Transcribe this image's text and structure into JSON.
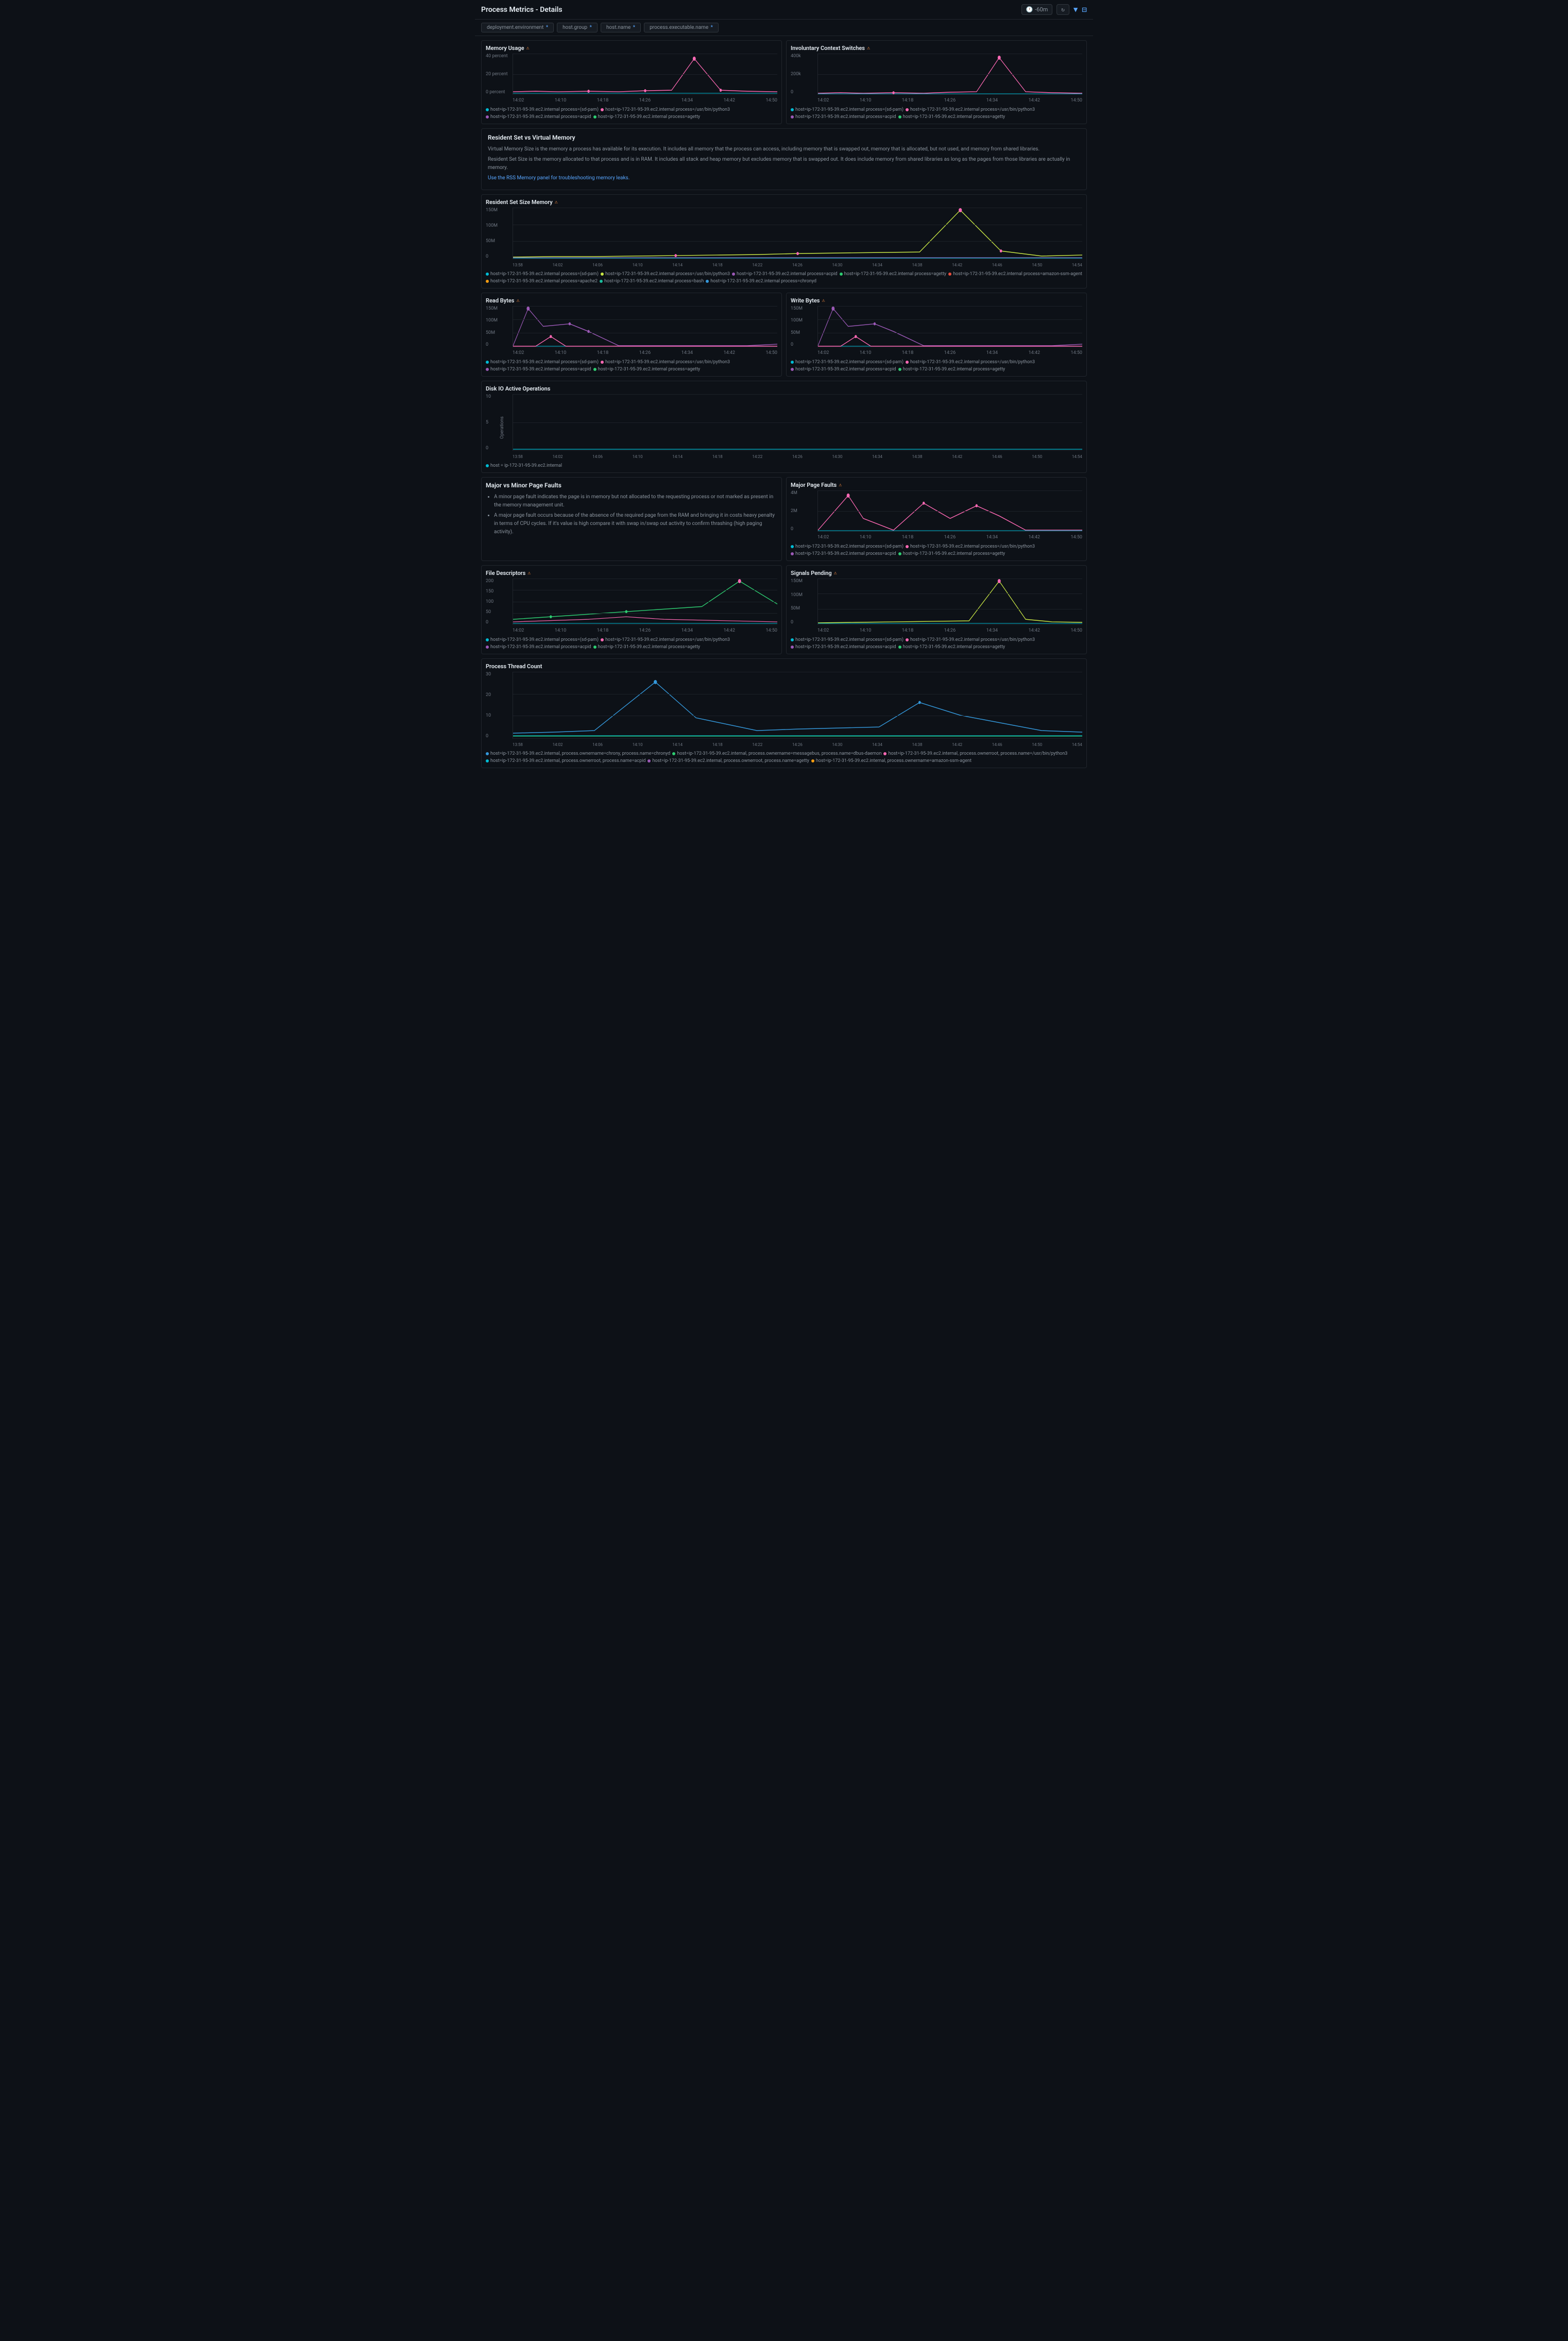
{
  "header": {
    "title": "Process Metrics - Details",
    "time_range": "-60m",
    "refresh_icon": "↻",
    "filter_icon": "▼"
  },
  "filter_tabs": [
    {
      "label": "deployment.environment",
      "has_asterisk": true
    },
    {
      "label": "host.group",
      "has_asterisk": true
    },
    {
      "label": "host.name",
      "has_asterisk": true
    },
    {
      "label": "process.executable.name",
      "has_asterisk": true
    }
  ],
  "sections": {
    "memory_usage": {
      "title": "Memory Usage",
      "has_alert": true,
      "y_labels": [
        "40 percent",
        "20 percent",
        "0 percent"
      ],
      "x_labels": [
        "14:02",
        "14:10",
        "14:18",
        "14:26",
        "14:34",
        "14:42",
        "14:50"
      ],
      "legend": [
        {
          "color": "#00bcd4",
          "label": "host=ip-172-31-95-39.ec2.internal process=(sd-pam)"
        },
        {
          "color": "#ff69b4",
          "label": "host=ip-172-31-95-39.ec2.internal process=/usr/bin/python3"
        },
        {
          "color": "#9b59b6",
          "label": "host=ip-172-31-95-39.ec2.internal process=acpid"
        },
        {
          "color": "#2ecc71",
          "label": "host=ip-172-31-95-39.ec2.internal process=agetty"
        }
      ]
    },
    "involuntary_context": {
      "title": "Involuntary Context Switches",
      "has_alert": true,
      "y_labels": [
        "400k",
        "200k",
        "0"
      ],
      "x_labels": [
        "14:02",
        "14:10",
        "14:18",
        "14:26",
        "14:34",
        "14:42",
        "14:50"
      ],
      "legend": [
        {
          "color": "#00bcd4",
          "label": "host=ip-172-31-95-39.ec2.internal process=(sd-pam)"
        },
        {
          "color": "#ff69b4",
          "label": "host=ip-172-31-95-39.ec2.internal process=/usr/bin/python3"
        },
        {
          "color": "#9b59b6",
          "label": "host=ip-172-31-95-39.ec2.internal process=acpid"
        },
        {
          "color": "#2ecc71",
          "label": "host=ip-172-31-95-39.ec2.internal process=agetty"
        }
      ]
    },
    "resident_vs_virtual": {
      "title": "Resident Set vs Virtual Memory",
      "description1": "Virtual Memory Size is the memory a process has available for its execution. It includes all memory that the process can access, including memory that is swapped out, memory that is allocated, but not used, and memory from shared libraries.",
      "description2": "Resident Set Size is the memory allocated to that process and is in RAM. It includes all stack and heap memory but excludes memory that is swapped out. It does include memory from shared libraries as long as the pages from those libraries are actually in memory.",
      "description3": "Use the RSS Memory panel for troubleshooting memory leaks."
    },
    "rss_memory": {
      "title": "Resident Set Size Memory",
      "has_alert": true,
      "y_labels": [
        "150M",
        "100M",
        "50M",
        "0"
      ],
      "x_labels": [
        "13:58",
        "14:02",
        "14:06",
        "14:10",
        "14:14",
        "14:18",
        "14:22",
        "14:26",
        "14:30",
        "14:34",
        "14:38",
        "14:42",
        "14:46",
        "14:50",
        "14:54"
      ],
      "legend": [
        {
          "color": "#00bcd4",
          "label": "host=ip-172-31-95-39.ec2.internal process=(sd-pam)"
        },
        {
          "color": "#ff69b4",
          "label": "host=ip-172-31-95-39.ec2.internal process=/usr/bin/python3"
        },
        {
          "color": "#9b59b6",
          "label": "host=ip-172-31-95-39.ec2.internal process=acpid"
        },
        {
          "color": "#2ecc71",
          "label": "host=ip-172-31-95-39.ec2.internal process=agetty"
        },
        {
          "color": "#e74c3c",
          "label": "host=ip-172-31-95-39.ec2.internal process=amazon-ssm-agent"
        },
        {
          "color": "#f39c12",
          "label": "host=ip-172-31-95-39.ec2.internal process=apache2"
        },
        {
          "color": "#1abc9c",
          "label": "host=ip-172-31-95-39.ec2.internal process=bash"
        },
        {
          "color": "#3498db",
          "label": "host=ip-172-31-95-39.ec2.internal process=chronyd"
        }
      ]
    },
    "read_bytes": {
      "title": "Read Bytes",
      "has_alert": true,
      "y_labels": [
        "150M",
        "100M",
        "50M",
        "0"
      ],
      "x_labels": [
        "14:02",
        "14:10",
        "14:18",
        "14:26",
        "14:34",
        "14:42",
        "14:50"
      ],
      "legend": [
        {
          "color": "#00bcd4",
          "label": "host=ip-172-31-95-39.ec2.internal process=(sd-pam)"
        },
        {
          "color": "#ff69b4",
          "label": "host=ip-172-31-95-39.ec2.internal process=/usr/bin/python3"
        },
        {
          "color": "#9b59b6",
          "label": "host=ip-172-31-95-39.ec2.internal process=acpid"
        },
        {
          "color": "#2ecc71",
          "label": "host=ip-172-31-95-39.ec2.internal process=agetty"
        }
      ]
    },
    "write_bytes": {
      "title": "Write Bytes",
      "has_alert": true,
      "y_labels": [
        "150M",
        "100M",
        "50M",
        "0"
      ],
      "x_labels": [
        "14:02",
        "14:10",
        "14:18",
        "14:26",
        "14:34",
        "14:42",
        "14:50"
      ],
      "legend": [
        {
          "color": "#00bcd4",
          "label": "host=ip-172-31-95-39.ec2.internal process=(sd-pam)"
        },
        {
          "color": "#ff69b4",
          "label": "host=ip-172-31-95-39.ec2.internal process=/usr/bin/python3"
        },
        {
          "color": "#9b59b6",
          "label": "host=ip-172-31-95-39.ec2.internal process=acpid"
        },
        {
          "color": "#2ecc71",
          "label": "host=ip-172-31-95-39.ec2.internal process=agetty"
        }
      ]
    },
    "disk_io": {
      "title": "Disk IO Active Operations",
      "y_labels": [
        "10",
        "5",
        "0"
      ],
      "x_labels": [
        "13:58",
        "14:02",
        "14:06",
        "14:10",
        "14:14",
        "14:18",
        "14:22",
        "14:26",
        "14:30",
        "14:34",
        "14:38",
        "14:42",
        "14:46",
        "14:50",
        "14:54"
      ],
      "ops_label": "Operations",
      "legend": [
        {
          "color": "#00bcd4",
          "label": "host = ip-172-31-95-39.ec2.internal"
        }
      ]
    },
    "major_vs_minor": {
      "title": "Major vs Minor Page Faults",
      "bullet1": "A minor page fault indicates the page is in memory but not allocated to the requesting process or not marked as present in the memory management unit.",
      "bullet2": "A major page fault occurs because of the absence of the required page from the RAM and bringing it in costs heavy penalty in terms of CPU cycles. If it's value is high compare it with swap in/swap out activity to confirm thrashing (high paging activity)."
    },
    "major_page_faults": {
      "title": "Major Page Faults",
      "has_alert": true,
      "y_labels": [
        "4M",
        "2M",
        "0"
      ],
      "x_labels": [
        "14:02",
        "14:10",
        "14:18",
        "14:26",
        "14:34",
        "14:42",
        "14:50"
      ],
      "legend": [
        {
          "color": "#00bcd4",
          "label": "host=ip-172-31-95-39.ec2.internal process=(sd-pam)"
        },
        {
          "color": "#ff69b4",
          "label": "host=ip-172-31-95-39.ec2.internal process=/usr/bin/python3"
        },
        {
          "color": "#9b59b6",
          "label": "host=ip-172-31-95-39.ec2.internal process=acpid"
        },
        {
          "color": "#2ecc71",
          "label": "host=ip-172-31-95-39.ec2.internal process=agetty"
        }
      ]
    },
    "file_descriptors": {
      "title": "File Descriptors",
      "has_alert": true,
      "y_labels": [
        "200",
        "150",
        "100",
        "50",
        "0"
      ],
      "x_labels": [
        "14:02",
        "14:10",
        "14:18",
        "14:26",
        "14:34",
        "14:42",
        "14:50"
      ],
      "legend": [
        {
          "color": "#00bcd4",
          "label": "host=ip-172-31-95-39.ec2.internal process=(sd-pam)"
        },
        {
          "color": "#ff69b4",
          "label": "host=ip-172-31-95-39.ec2.internal process=/usr/bin/python3"
        },
        {
          "color": "#9b59b6",
          "label": "host=ip-172-31-95-39.ec2.internal process=acpid"
        },
        {
          "color": "#2ecc71",
          "label": "host=ip-172-31-95-39.ec2.internal process=agetty"
        }
      ]
    },
    "signals_pending": {
      "title": "Signals Pending",
      "has_alert": true,
      "y_labels": [
        "150M",
        "100M",
        "50M",
        "0"
      ],
      "x_labels": [
        "14:02",
        "14:10",
        "14:18",
        "14:26",
        "14:34",
        "14:42",
        "14:50"
      ],
      "legend": [
        {
          "color": "#00bcd4",
          "label": "host=ip-172-31-95-39.ec2.internal process=(sd-pam)"
        },
        {
          "color": "#ff69b4",
          "label": "host=ip-172-31-95-39.ec2.internal process=/usr/bin/python3"
        },
        {
          "color": "#9b59b6",
          "label": "host=ip-172-31-95-39.ec2.internal process=acpid"
        },
        {
          "color": "#2ecc71",
          "label": "host=ip-172-31-95-39.ec2.internal process=agetty"
        }
      ]
    },
    "thread_count": {
      "title": "Process Thread Count",
      "y_labels": [
        "30",
        "20",
        "10",
        "0"
      ],
      "x_labels": [
        "13:58",
        "14:02",
        "14:06",
        "14:10",
        "14:14",
        "14:18",
        "14:22",
        "14:26",
        "14:30",
        "14:34",
        "14:38",
        "14:42",
        "14:46",
        "14:50",
        "14:54"
      ],
      "legend": [
        {
          "color": "#3498db",
          "label": "host=ip-172-31-95-39.ec2.internal, process.ownername=chrony, process.name=chronyd"
        },
        {
          "color": "#2ecc71",
          "label": "host=ip-172-31-95-39.ec2.internal, process.ownername=messagebus, process.name=dbus-daemon"
        },
        {
          "color": "#ff69b4",
          "label": "host=ip-172-31-95-39.ec2.internal, process.ownerroot, process.name=/usr/bin/python3"
        },
        {
          "color": "#00bcd4",
          "label": "host=ip-172-31-95-39.ec2.internal, process.ownerroot, process.name=acpid"
        },
        {
          "color": "#9b59b6",
          "label": "host=ip-172-31-95-39.ec2.internal, process.ownerroot, process.name=agetty"
        },
        {
          "color": "#f39c12",
          "label": "host=ip-172-31-95-39.ec2.internal, process.ownername=amazon-ssm-agent"
        }
      ]
    }
  }
}
